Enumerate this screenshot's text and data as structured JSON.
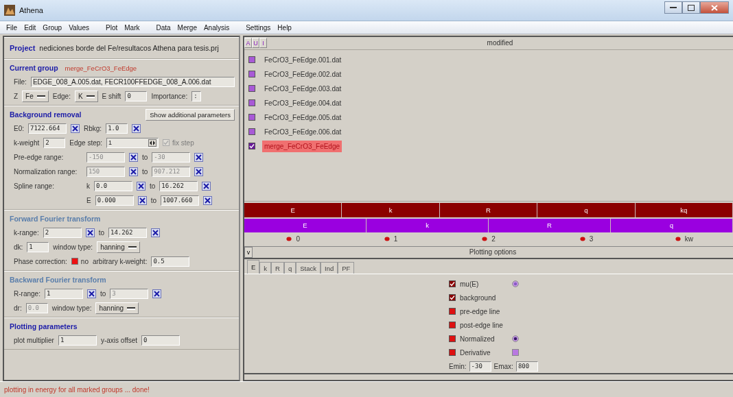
{
  "window": {
    "title": "Athena"
  },
  "menu": [
    {
      "label": "File"
    },
    {
      "label": "Edit"
    },
    {
      "label": "Group"
    },
    {
      "label": "Values"
    },
    {
      "label": "Plot"
    },
    {
      "label": "Mark"
    },
    {
      "label": "Data"
    },
    {
      "label": "Merge"
    },
    {
      "label": "Analysis"
    },
    {
      "label": "Settings"
    },
    {
      "label": "Help"
    }
  ],
  "project": {
    "label": "Project",
    "value": "nediciones borde del Fe/resultacos Athena para tesis.prj"
  },
  "sections": [
    {
      "title": "Current group",
      "subtitle": "merge_FeCrO3_FeEdge",
      "dimmed": false,
      "rows": [
        {
          "kind": "line",
          "items": [
            {
              "kind": "label",
              "text": "File:"
            },
            {
              "kind": "wide-field",
              "value": "EDGE_008_A.005.dat, FECR100FFEDGE_008_A.006.dat",
              "disabled": false
            }
          ]
        },
        {
          "kind": "line",
          "items": [
            {
              "kind": "label",
              "text": "Z"
            },
            {
              "kind": "select",
              "value": "Fe"
            },
            {
              "kind": "label",
              "text": "Edge:"
            },
            {
              "kind": "select",
              "value": "K"
            },
            {
              "kind": "label",
              "text": "E shift"
            },
            {
              "kind": "small-field",
              "value": "0",
              "disabled": false
            },
            {
              "kind": "label",
              "text": "Importance:"
            },
            {
              "kind": "tiny-field",
              "value": ":",
              "disabled": false
            }
          ]
        }
      ]
    },
    {
      "title": "Background removal",
      "button": "Show additional parameters",
      "dimmed": false,
      "rows": [
        {
          "kind": "line",
          "items": [
            {
              "kind": "label",
              "text": "E0:"
            },
            {
              "kind": "field",
              "value": "7122.664",
              "disabled": false
            },
            {
              "kind": "pick"
            },
            {
              "kind": "label",
              "text": "Rbkg:"
            },
            {
              "kind": "small-field",
              "value": "1.0",
              "disabled": false
            },
            {
              "kind": "pick"
            }
          ]
        },
        {
          "kind": "line",
          "items": [
            {
              "kind": "label",
              "text": "k-weight"
            },
            {
              "kind": "small-field",
              "value": "2",
              "disabled": false
            },
            {
              "kind": "label",
              "text": "Edge step:"
            },
            {
              "kind": "spin",
              "value": "1"
            },
            {
              "kind": "check",
              "text": "fix step",
              "checked": true,
              "disabled": true
            }
          ]
        },
        {
          "kind": "range",
          "items": [
            {
              "kind": "label",
              "text": "Pre-edge range:"
            },
            {
              "kind": "field",
              "value": "-150",
              "disabled": true
            },
            {
              "kind": "pick"
            },
            {
              "kind": "label",
              "text": "to"
            },
            {
              "kind": "field",
              "value": "-30",
              "disabled": true
            },
            {
              "kind": "pick"
            }
          ]
        },
        {
          "kind": "range",
          "items": [
            {
              "kind": "label",
              "text": "Normalization range:"
            },
            {
              "kind": "field",
              "value": "150",
              "disabled": true
            },
            {
              "kind": "pick"
            },
            {
              "kind": "label",
              "text": "to"
            },
            {
              "kind": "field",
              "value": "907.212",
              "disabled": true
            },
            {
              "kind": "pick"
            }
          ]
        },
        {
          "kind": "range",
          "items": [
            {
              "kind": "label",
              "text": "Spline range:"
            },
            {
              "kind": "label",
              "text": "k"
            },
            {
              "kind": "field",
              "value": "0.0",
              "disabled": false
            },
            {
              "kind": "pick"
            },
            {
              "kind": "label",
              "text": "to"
            },
            {
              "kind": "field",
              "value": "16.262",
              "disabled": false
            },
            {
              "kind": "pick"
            }
          ]
        },
        {
          "kind": "range-cont",
          "items": [
            {
              "kind": "label",
              "text": "E"
            },
            {
              "kind": "field",
              "value": "0.000",
              "disabled": false
            },
            {
              "kind": "pick"
            },
            {
              "kind": "label",
              "text": "to"
            },
            {
              "kind": "field",
              "value": "1007.660",
              "disabled": false
            },
            {
              "kind": "pick"
            }
          ]
        }
      ]
    },
    {
      "title": "Forward Fourier transform",
      "dimmed": true,
      "rows": [
        {
          "kind": "line",
          "items": [
            {
              "kind": "label",
              "text": "k-range:"
            },
            {
              "kind": "field",
              "value": "2",
              "disabled": false
            },
            {
              "kind": "pick"
            },
            {
              "kind": "label",
              "text": "to"
            },
            {
              "kind": "field",
              "value": "14.262",
              "disabled": false
            },
            {
              "kind": "pick"
            }
          ]
        },
        {
          "kind": "line",
          "items": [
            {
              "kind": "label",
              "text": "dk:"
            },
            {
              "kind": "small-field",
              "value": "1",
              "disabled": false
            },
            {
              "kind": "label",
              "text": "window type:"
            },
            {
              "kind": "select",
              "value": "hanning"
            }
          ]
        },
        {
          "kind": "line",
          "items": [
            {
              "kind": "label",
              "text": "Phase correction:"
            },
            {
              "kind": "check",
              "text": "no",
              "checked": false,
              "disabled": false
            },
            {
              "kind": "label",
              "text": "arbitrary k-weight:"
            },
            {
              "kind": "field",
              "value": "0.5",
              "disabled": false
            }
          ]
        }
      ]
    },
    {
      "title": "Backward Fourier transform",
      "dimmed": true,
      "rows": [
        {
          "kind": "line",
          "items": [
            {
              "kind": "label",
              "text": "R-range:"
            },
            {
              "kind": "field",
              "value": "1",
              "disabled": false
            },
            {
              "kind": "pick"
            },
            {
              "kind": "label",
              "text": "to"
            },
            {
              "kind": "field",
              "value": "3",
              "disabled": true
            },
            {
              "kind": "pick"
            }
          ]
        },
        {
          "kind": "line",
          "items": [
            {
              "kind": "label",
              "text": "dr:"
            },
            {
              "kind": "small-field",
              "value": "0.0",
              "disabled": true
            },
            {
              "kind": "label",
              "text": "window type:"
            },
            {
              "kind": "select",
              "value": "hanning"
            }
          ]
        }
      ]
    },
    {
      "title": "Plotting parameters",
      "dimmed": false,
      "rows": [
        {
          "kind": "line",
          "items": [
            {
              "kind": "label",
              "text": "plot multiplier"
            },
            {
              "kind": "field",
              "value": "1",
              "disabled": false
            },
            {
              "kind": "label",
              "text": "y-axis offset"
            },
            {
              "kind": "field",
              "value": "0",
              "disabled": false
            }
          ]
        }
      ]
    }
  ],
  "group_toolbar": {
    "buttons": [
      {
        "label": "A"
      },
      {
        "label": "U"
      },
      {
        "label": "I"
      }
    ],
    "status": "modified"
  },
  "groups": [
    {
      "name": "FeCrO3_FeEdge.001.dat",
      "checked": false,
      "selected": false
    },
    {
      "name": "FeCrO3_FeEdge.002.dat",
      "checked": false,
      "selected": false
    },
    {
      "name": "FeCrO3_FeEdge.003.dat",
      "checked": false,
      "selected": false
    },
    {
      "name": "FeCrO3_FeEdge.004.dat",
      "checked": false,
      "selected": false
    },
    {
      "name": "FeCrO3_FeEdge.005.dat",
      "checked": false,
      "selected": false
    },
    {
      "name": "FeCrO3_FeEdge.006.dat",
      "checked": false,
      "selected": false
    },
    {
      "name": "merge_FeCrO3_FeEdge",
      "checked": true,
      "selected": true
    }
  ],
  "plot_current": [
    {
      "label": "E"
    },
    {
      "label": "k"
    },
    {
      "label": "R"
    },
    {
      "label": "q"
    },
    {
      "label": "kq"
    }
  ],
  "plot_marked": [
    {
      "label": "E"
    },
    {
      "label": "k"
    },
    {
      "label": "R"
    },
    {
      "label": "q"
    }
  ],
  "kweights": [
    {
      "label": "0",
      "selected": false
    },
    {
      "label": "1",
      "selected": false
    },
    {
      "label": "2",
      "selected": false
    },
    {
      "label": "3",
      "selected": false
    },
    {
      "label": "kw",
      "selected": false
    }
  ],
  "plot_options": {
    "toggle": "v",
    "title": "Plotting options"
  },
  "tabs": [
    {
      "label": "E",
      "selected": true
    },
    {
      "label": "k",
      "selected": false
    },
    {
      "label": "R",
      "selected": false
    },
    {
      "label": "q",
      "selected": false
    },
    {
      "label": "Stack",
      "selected": false
    },
    {
      "label": "Ind",
      "selected": false
    },
    {
      "label": "PF",
      "selected": false
    }
  ],
  "options": [
    {
      "label": "mu(E)",
      "checked": true,
      "kind": "radio",
      "selected": false
    },
    {
      "label": "background",
      "checked": true,
      "kind": "plain"
    },
    {
      "label": "pre-edge line",
      "checked": false,
      "kind": "plain"
    },
    {
      "label": "post-edge line",
      "checked": false,
      "kind": "plain"
    },
    {
      "label": "Normalized",
      "checked": false,
      "kind": "radio",
      "selected": true
    },
    {
      "label": "Derivative",
      "checked": false,
      "kind": "square",
      "selected": false
    }
  ],
  "energy_range": [
    {
      "label": "Emin:",
      "value": "-30"
    },
    {
      "label": "Emax:",
      "value": "800"
    }
  ],
  "status_bar": "plotting in energy for all marked groups ... done!"
}
